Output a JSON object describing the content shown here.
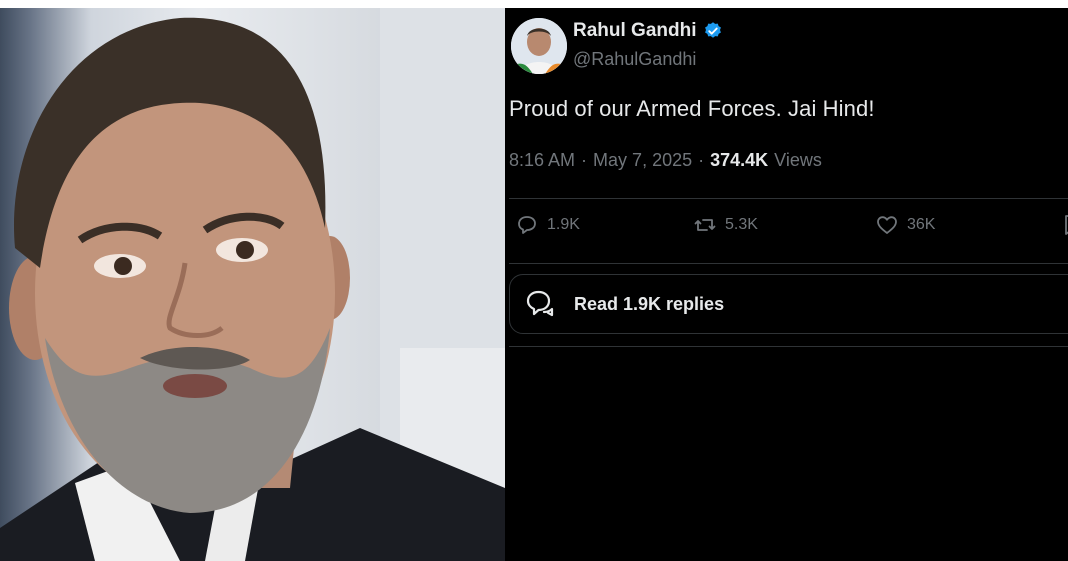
{
  "photo": {
    "subject": "portrait-photo"
  },
  "tweet": {
    "author_name": "Rahul Gandhi",
    "handle": "@RahulGandhi",
    "body": "Proud of our Armed Forces. Jai Hind!",
    "time": "8:16 AM",
    "separator": "·",
    "date": "May 7, 2025",
    "views_count": "374.4K",
    "views_label": "Views",
    "replies": "1.9K",
    "reposts": "5.3K",
    "likes": "36K",
    "read_replies_label": "Read 1.9K replies"
  },
  "colors": {
    "background": "#000000",
    "text": "#e7e9ea",
    "muted": "#71767b",
    "verified": "#1d9bf0"
  },
  "icons": [
    "verified-badge-icon",
    "reply-icon",
    "repost-icon",
    "like-icon",
    "bookmark-icon",
    "chat-bubbles-icon"
  ]
}
